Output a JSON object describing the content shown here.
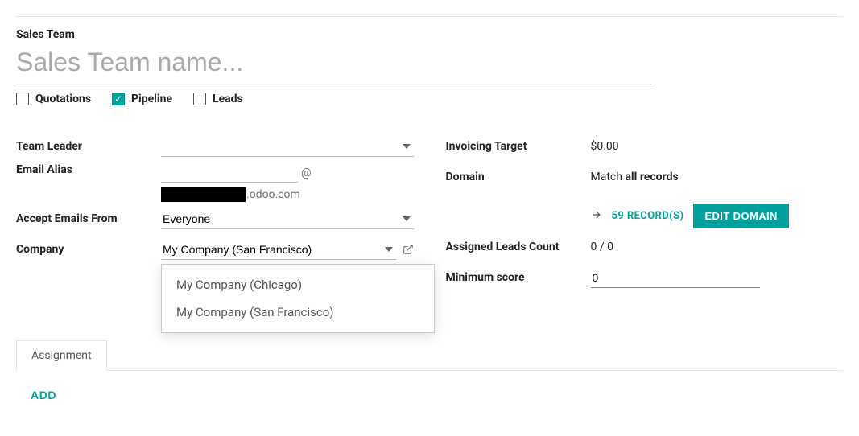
{
  "title_label": "Sales Team",
  "title_placeholder": "Sales Team name...",
  "checkboxes": {
    "quotations": {
      "label": "Quotations",
      "checked": false
    },
    "pipeline": {
      "label": "Pipeline",
      "checked": true
    },
    "leads": {
      "label": "Leads",
      "checked": false
    }
  },
  "left": {
    "team_leader_label": "Team Leader",
    "team_leader_value": "",
    "email_alias_label": "Email Alias",
    "alias_local": "",
    "alias_at": "@",
    "alias_domain_suffix": ".odoo.com",
    "accept_from_label": "Accept Emails From",
    "accept_from_value": "Everyone",
    "company_label": "Company",
    "company_value": "My Company (San Francisco)",
    "company_options": [
      "My Company (Chicago)",
      "My Company (San Francisco)"
    ]
  },
  "right": {
    "invoicing_target_label": "Invoicing Target",
    "invoicing_target_value": "$0.00",
    "domain_label": "Domain",
    "domain_match_prefix": "Match ",
    "domain_match_bold": "all records",
    "records_link": "59 RECORD(S)",
    "edit_domain_btn": "EDIT DOMAIN",
    "assigned_leads_label": "Assigned Leads Count",
    "assigned_leads_value": "0 / 0",
    "min_score_label": "Minimum score",
    "min_score_value": "0"
  },
  "tab": {
    "assignment_label": "Assignment",
    "add_label": "ADD"
  }
}
